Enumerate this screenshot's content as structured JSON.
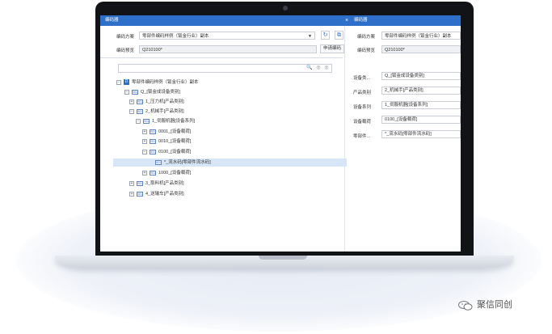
{
  "tabs": {
    "left": "编码器",
    "right": "编码器",
    "close": "×"
  },
  "left_form": {
    "scheme_label": "编码方案",
    "scheme_value": "零部件编码样例（钣金行业）副本",
    "preview_label": "编码预览",
    "preview_value": "Q210100*",
    "apply_button": "申请编码"
  },
  "right_form": {
    "scheme_label": "编码方案",
    "scheme_value": "零部件编码样例（钣金行业）副本",
    "preview_label": "编码预览",
    "preview_value": "Q210100*"
  },
  "tree": {
    "root": "零部件编码样例（钣金行业）副本",
    "nodes": [
      {
        "label": "Q_[钣金成设备类别]",
        "expander": "⊟"
      },
      {
        "label": "1_压力机[产品类别]",
        "expander": "⊞"
      },
      {
        "label": "2_机械手[产品类别]",
        "expander": "⊟"
      },
      {
        "label": "1_伺服机器[设备系列]",
        "expander": "⊟"
      },
      {
        "label": "0001_[设备载荷]",
        "expander": "⊞"
      },
      {
        "label": "0010_[设备载荷]",
        "expander": "⊞"
      },
      {
        "label": "0100_[设备载荷]",
        "expander": "⊟"
      },
      {
        "label": "*_流水码[零部件流水码]",
        "expander": ""
      },
      {
        "label": "1000_[设备载荷]",
        "expander": "⊞"
      },
      {
        "label": "3_取料机[产品类别]",
        "expander": "⊞"
      },
      {
        "label": "4_送输车[产品类别]",
        "expander": "⊞"
      }
    ]
  },
  "properties": [
    {
      "label": "设备类...",
      "value": "Q_[钣金成设备类别]"
    },
    {
      "label": "产品类别",
      "value": "2_机械手[产品类别]"
    },
    {
      "label": "设备系列",
      "value": "1_伺服机器[设备系列]"
    },
    {
      "label": "设备载荷",
      "value": "0100_[设备载荷]"
    },
    {
      "label": "零部件...",
      "value": "*_流水码[零部件流水码]"
    }
  ],
  "brand": {
    "text": "聚信同创"
  }
}
